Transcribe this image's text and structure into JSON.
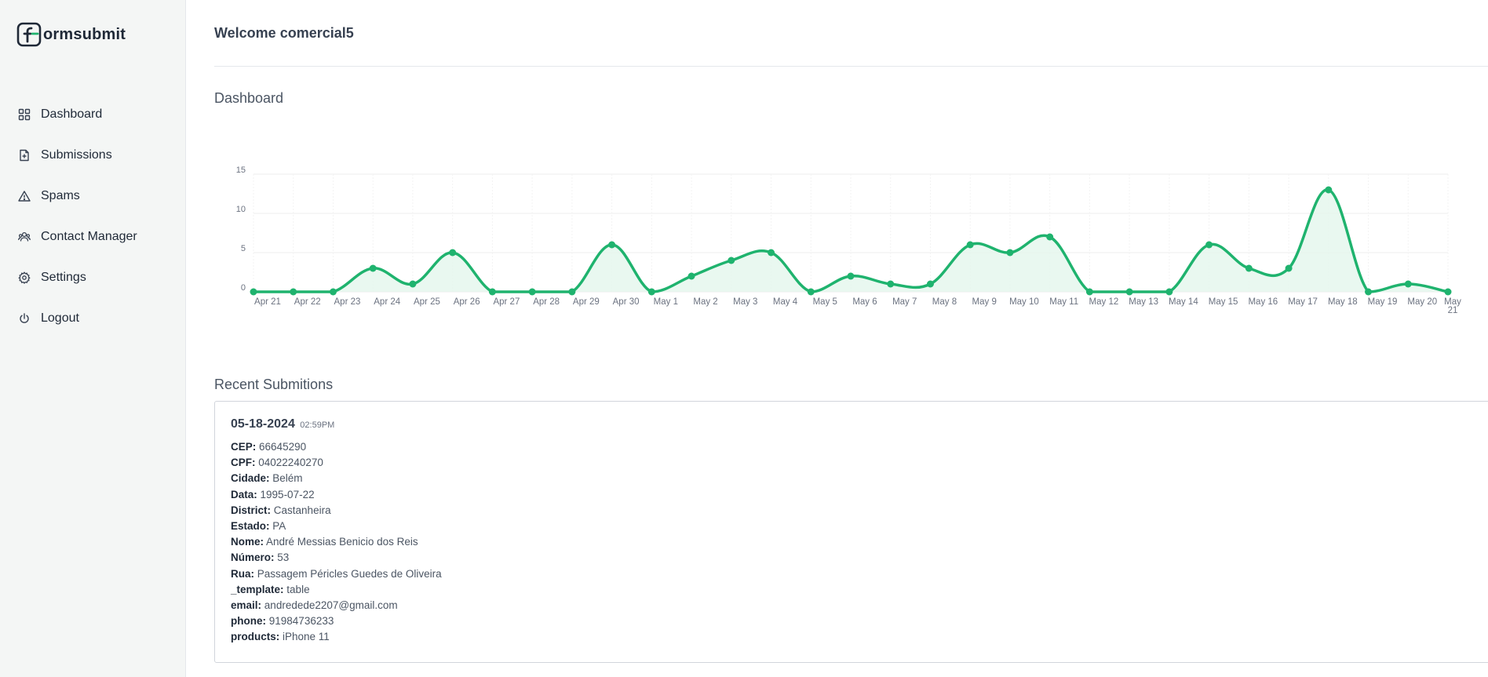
{
  "brand": {
    "name": "ormsubmit",
    "logo_letter": "f"
  },
  "sidebar": {
    "items": [
      {
        "label": "Dashboard",
        "icon": "grid-icon"
      },
      {
        "label": "Submissions",
        "icon": "file-plus-icon"
      },
      {
        "label": "Spams",
        "icon": "alert-triangle-icon"
      },
      {
        "label": "Contact Manager",
        "icon": "users-icon"
      },
      {
        "label": "Settings",
        "icon": "gear-icon"
      },
      {
        "label": "Logout",
        "icon": "power-icon"
      }
    ]
  },
  "header": {
    "welcome": "Welcome comercial5"
  },
  "dashboard": {
    "title": "Dashboard"
  },
  "colors": {
    "accent": "#1fb36e",
    "fill": "#e3f6ec",
    "grid": "#eeeeee"
  },
  "chart_data": {
    "type": "area",
    "x": [
      "Apr 21",
      "Apr 22",
      "Apr 23",
      "Apr 24",
      "Apr 25",
      "Apr 26",
      "Apr 27",
      "Apr 28",
      "Apr 29",
      "Apr 30",
      "May 1",
      "May 2",
      "May 3",
      "May 4",
      "May 5",
      "May 6",
      "May 7",
      "May 8",
      "May 9",
      "May 10",
      "May 11",
      "May 12",
      "May 13",
      "May 14",
      "May 15",
      "May 16",
      "May 17",
      "May 18",
      "May 19",
      "May 20",
      "May 21"
    ],
    "values": [
      0,
      0,
      0,
      3,
      1,
      5,
      0,
      0,
      0,
      6,
      0,
      2,
      4,
      5,
      0,
      2,
      1,
      1,
      6,
      5,
      7,
      0,
      0,
      0,
      6,
      3,
      3,
      13,
      0,
      1,
      0
    ],
    "yticks": [
      0,
      5,
      10,
      15
    ],
    "ylim": [
      0,
      15
    ],
    "grid": true,
    "curve": "smooth"
  },
  "recent": {
    "title": "Recent Submitions",
    "date": "05-18-2024",
    "time": "02:59PM",
    "fields": [
      {
        "key": "CEP:",
        "value": "66645290"
      },
      {
        "key": "CPF:",
        "value": "04022240270"
      },
      {
        "key": "Cidade:",
        "value": "Belém"
      },
      {
        "key": "Data:",
        "value": "1995-07-22"
      },
      {
        "key": "District:",
        "value": "Castanheira"
      },
      {
        "key": "Estado:",
        "value": "PA"
      },
      {
        "key": "Nome:",
        "value": "André Messias Benicio dos Reis"
      },
      {
        "key": "Número:",
        "value": "53"
      },
      {
        "key": "Rua:",
        "value": "Passagem Péricles Guedes de Oliveira"
      },
      {
        "key": "_template:",
        "value": "table"
      },
      {
        "key": "email:",
        "value": "andredede2207@gmail.com"
      },
      {
        "key": "phone:",
        "value": "91984736233"
      },
      {
        "key": "products:",
        "value": "iPhone 11"
      }
    ]
  }
}
